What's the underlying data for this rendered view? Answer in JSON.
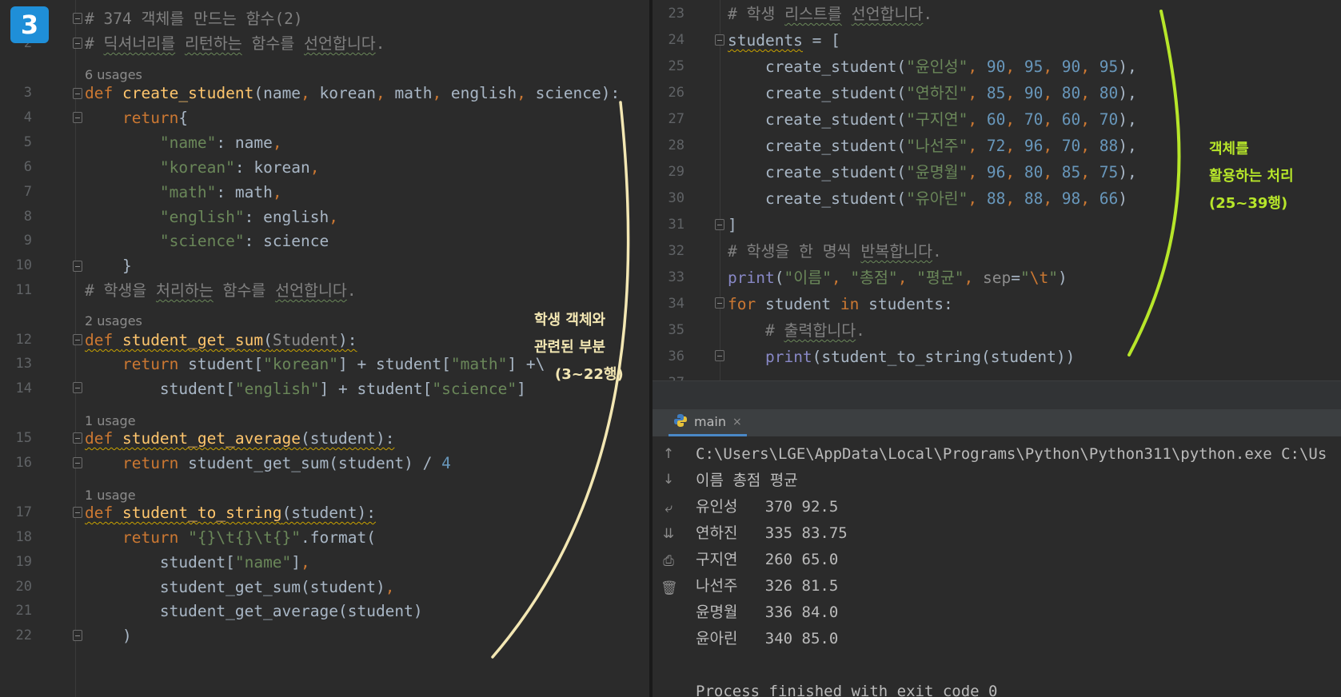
{
  "badge": "3",
  "left_editor": {
    "lines": [
      {
        "n": "",
        "parts": [
          [
            "cm",
            "# 374 객체를 만드는 함수(2)"
          ]
        ]
      },
      {
        "n": "2",
        "parts": [
          [
            "cm",
            "# "
          ],
          [
            "cm sq",
            "딕셔너리를"
          ],
          [
            "cm",
            " "
          ],
          [
            "cm sq",
            "리턴하는"
          ],
          [
            "cm",
            " 함수를 "
          ],
          [
            "cm sq",
            "선언합니다"
          ],
          [
            "cm",
            "."
          ]
        ]
      },
      {
        "n": "3",
        "parts": [
          [
            "kw",
            "def "
          ],
          [
            "fn",
            "create_student"
          ],
          [
            "",
            "(name"
          ],
          [
            "kw",
            ", "
          ],
          [
            "",
            "korean"
          ],
          [
            "kw",
            ", "
          ],
          [
            "",
            "math"
          ],
          [
            "kw",
            ", "
          ],
          [
            "",
            "english"
          ],
          [
            "kw",
            ", "
          ],
          [
            "",
            "science):"
          ]
        ]
      },
      {
        "n": "4",
        "parts": [
          [
            "",
            "    "
          ],
          [
            "kw",
            "return"
          ],
          [
            "",
            "{"
          ]
        ]
      },
      {
        "n": "5",
        "parts": [
          [
            "",
            "        "
          ],
          [
            "str",
            "\"name\""
          ],
          [
            "",
            ": name"
          ],
          [
            "kw",
            ","
          ]
        ]
      },
      {
        "n": "6",
        "parts": [
          [
            "",
            "        "
          ],
          [
            "str",
            "\"korean\""
          ],
          [
            "",
            ": korean"
          ],
          [
            "kw",
            ","
          ]
        ]
      },
      {
        "n": "7",
        "parts": [
          [
            "",
            "        "
          ],
          [
            "str",
            "\"math\""
          ],
          [
            "",
            ": math"
          ],
          [
            "kw",
            ","
          ]
        ]
      },
      {
        "n": "8",
        "parts": [
          [
            "",
            "        "
          ],
          [
            "str",
            "\"english\""
          ],
          [
            "",
            ": english"
          ],
          [
            "kw",
            ","
          ]
        ]
      },
      {
        "n": "9",
        "parts": [
          [
            "",
            "        "
          ],
          [
            "str",
            "\"science\""
          ],
          [
            "",
            ": science"
          ]
        ]
      },
      {
        "n": "10",
        "parts": [
          [
            "",
            "    }"
          ]
        ]
      },
      {
        "n": "11",
        "parts": [
          [
            "cm",
            "# 학생을 "
          ],
          [
            "cm sq",
            "처리하는"
          ],
          [
            "cm",
            " 함수를 "
          ],
          [
            "cm sq",
            "선언합니다"
          ],
          [
            "cm",
            "."
          ]
        ]
      },
      {
        "n": "12",
        "parts": [
          [
            "kw sq-y",
            "def "
          ],
          [
            "fn sq-y",
            "student_get_sum"
          ],
          [
            "sq-y",
            "("
          ],
          [
            "param-gray sq-y",
            "Student"
          ],
          [
            "sq-y",
            "):"
          ]
        ]
      },
      {
        "n": "13",
        "parts": [
          [
            "",
            "    "
          ],
          [
            "kw",
            "return "
          ],
          [
            "",
            "student["
          ],
          [
            "str",
            "\"korean\""
          ],
          [
            "",
            "] + student["
          ],
          [
            "str",
            "\"math\""
          ],
          [
            "",
            "] +\\"
          ]
        ]
      },
      {
        "n": "14",
        "parts": [
          [
            "",
            "        student["
          ],
          [
            "str",
            "\"english\""
          ],
          [
            "",
            "] + student["
          ],
          [
            "str",
            "\"science\""
          ],
          [
            "",
            "]"
          ]
        ]
      },
      {
        "n": "15",
        "parts": [
          [
            "kw sq-y",
            "def "
          ],
          [
            "fn sq-y",
            "student_get_average"
          ],
          [
            "sq-y",
            "(student):"
          ]
        ]
      },
      {
        "n": "16",
        "parts": [
          [
            "",
            "    "
          ],
          [
            "kw",
            "return "
          ],
          [
            "",
            "student_get_sum(student) / "
          ],
          [
            "num",
            "4"
          ]
        ]
      },
      {
        "n": "17",
        "parts": [
          [
            "kw sq-y",
            "def "
          ],
          [
            "fn sq-y",
            "student_to_string"
          ],
          [
            "sq-y",
            "(student):"
          ]
        ]
      },
      {
        "n": "18",
        "parts": [
          [
            "",
            "    "
          ],
          [
            "kw",
            "return "
          ],
          [
            "str",
            "\"{}\\t{}\\t{}\""
          ],
          [
            "",
            ".format("
          ]
        ]
      },
      {
        "n": "19",
        "parts": [
          [
            "",
            "        student["
          ],
          [
            "str",
            "\"name\""
          ],
          [
            "",
            "]"
          ],
          [
            "kw",
            ","
          ]
        ]
      },
      {
        "n": "20",
        "parts": [
          [
            "",
            "        student_get_sum(student)"
          ],
          [
            "kw",
            ","
          ]
        ]
      },
      {
        "n": "21",
        "parts": [
          [
            "",
            "        student_get_average(student)"
          ]
        ]
      },
      {
        "n": "22",
        "parts": [
          [
            "",
            "    )"
          ]
        ]
      }
    ],
    "usages": [
      "6 usages",
      "2 usages",
      "1 usage",
      "1 usage"
    ]
  },
  "right_editor": {
    "lines": [
      {
        "n": "23",
        "parts": [
          [
            "cm",
            "# 학생 "
          ],
          [
            "cm sq",
            "리스트를"
          ],
          [
            "cm",
            " "
          ],
          [
            "cm sq",
            "선언합니다"
          ],
          [
            "cm",
            "."
          ]
        ]
      },
      {
        "n": "24",
        "parts": [
          [
            "sq-y",
            "students"
          ],
          [
            "",
            " = ["
          ]
        ]
      },
      {
        "n": "25",
        "parts": [
          [
            "",
            "    create_student("
          ],
          [
            "str",
            "\"윤인성\""
          ],
          [
            "kw",
            ", "
          ],
          [
            "num",
            "90"
          ],
          [
            "kw",
            ", "
          ],
          [
            "num",
            "95"
          ],
          [
            "kw",
            ", "
          ],
          [
            "num",
            "90"
          ],
          [
            "kw",
            ", "
          ],
          [
            "num",
            "95"
          ],
          [
            "",
            "),"
          ]
        ]
      },
      {
        "n": "26",
        "parts": [
          [
            "",
            "    create_student("
          ],
          [
            "str",
            "\"연하진\""
          ],
          [
            "kw",
            ", "
          ],
          [
            "num",
            "85"
          ],
          [
            "kw",
            ", "
          ],
          [
            "num",
            "90"
          ],
          [
            "kw",
            ", "
          ],
          [
            "num",
            "80"
          ],
          [
            "kw",
            ", "
          ],
          [
            "num",
            "80"
          ],
          [
            "",
            "),"
          ]
        ]
      },
      {
        "n": "27",
        "parts": [
          [
            "",
            "    create_student("
          ],
          [
            "str",
            "\"구지연\""
          ],
          [
            "kw",
            ", "
          ],
          [
            "num",
            "60"
          ],
          [
            "kw",
            ", "
          ],
          [
            "num",
            "70"
          ],
          [
            "kw",
            ", "
          ],
          [
            "num",
            "60"
          ],
          [
            "kw",
            ", "
          ],
          [
            "num",
            "70"
          ],
          [
            "",
            "),"
          ]
        ]
      },
      {
        "n": "28",
        "parts": [
          [
            "",
            "    create_student("
          ],
          [
            "str",
            "\"나선주\""
          ],
          [
            "kw",
            ", "
          ],
          [
            "num",
            "72"
          ],
          [
            "kw",
            ", "
          ],
          [
            "num",
            "96"
          ],
          [
            "kw",
            ", "
          ],
          [
            "num",
            "70"
          ],
          [
            "kw",
            ", "
          ],
          [
            "num",
            "88"
          ],
          [
            "",
            "),"
          ]
        ]
      },
      {
        "n": "29",
        "parts": [
          [
            "",
            "    create_student("
          ],
          [
            "str",
            "\"윤명월\""
          ],
          [
            "kw",
            ", "
          ],
          [
            "num",
            "96"
          ],
          [
            "kw",
            ", "
          ],
          [
            "num",
            "80"
          ],
          [
            "kw",
            ", "
          ],
          [
            "num",
            "85"
          ],
          [
            "kw",
            ", "
          ],
          [
            "num",
            "75"
          ],
          [
            "",
            "),"
          ]
        ]
      },
      {
        "n": "30",
        "parts": [
          [
            "",
            "    create_student("
          ],
          [
            "str",
            "\"유아린\""
          ],
          [
            "kw",
            ", "
          ],
          [
            "num",
            "88"
          ],
          [
            "kw",
            ", "
          ],
          [
            "num",
            "88"
          ],
          [
            "kw",
            ", "
          ],
          [
            "num",
            "98"
          ],
          [
            "kw",
            ", "
          ],
          [
            "num",
            "66"
          ],
          [
            "",
            ")"
          ]
        ]
      },
      {
        "n": "31",
        "parts": [
          [
            "",
            "]"
          ]
        ]
      },
      {
        "n": "32",
        "parts": [
          [
            "cm",
            "# 학생을 한 명씩 "
          ],
          [
            "cm sq",
            "반복합니다"
          ],
          [
            "cm",
            "."
          ]
        ]
      },
      {
        "n": "33",
        "parts": [
          [
            "bi",
            "print"
          ],
          [
            "",
            "("
          ],
          [
            "str",
            "\"이름\""
          ],
          [
            "kw",
            ", "
          ],
          [
            "str",
            "\"총점\""
          ],
          [
            "kw",
            ", "
          ],
          [
            "str",
            "\"평균\""
          ],
          [
            "kw",
            ", "
          ],
          [
            "param-gray",
            "sep"
          ],
          [
            "",
            "="
          ],
          [
            "str",
            "\""
          ],
          [
            "kw",
            "\\t"
          ],
          [
            "str",
            "\""
          ],
          [
            "",
            ")"
          ]
        ]
      },
      {
        "n": "34",
        "parts": [
          [
            "kw",
            "for "
          ],
          [
            "",
            "student "
          ],
          [
            "kw",
            "in "
          ],
          [
            "",
            "students:"
          ]
        ]
      },
      {
        "n": "35",
        "parts": [
          [
            "",
            "    "
          ],
          [
            "cm",
            "# "
          ],
          [
            "cm sq",
            "출력합니다"
          ],
          [
            "cm",
            "."
          ]
        ]
      },
      {
        "n": "36",
        "parts": [
          [
            "",
            "    "
          ],
          [
            "bi",
            "print"
          ],
          [
            "",
            "(student_to_string(student))"
          ]
        ]
      },
      {
        "n": "37",
        "parts": [
          [
            "",
            ""
          ]
        ]
      }
    ]
  },
  "annotations": {
    "left": [
      "학생 객체와",
      "관련된 부분",
      "(3~22행)"
    ],
    "right": [
      "객체를",
      "활용하는 처리",
      "(25~39행)"
    ],
    "left_color": "#f3e7b3",
    "right_color": "#b7e62a"
  },
  "run": {
    "tab_label": "main",
    "tab_close": "×",
    "output": [
      "C:\\Users\\LGE\\AppData\\Local\\Programs\\Python\\Python311\\python.exe C:\\Us",
      "이름 총점 평균",
      "유인성   370 92.5",
      "연하진   335 83.75",
      "구지연   260 65.0",
      "나선주   326 81.5",
      "윤명월   336 84.0",
      "윤아린   340 85.0",
      "",
      "Process finished with exit code 0"
    ],
    "tools": [
      "arrow-up-icon",
      "arrow-down-icon",
      "soft-wrap-icon",
      "scroll-to-end-icon",
      "print-icon",
      "trash-icon"
    ]
  }
}
